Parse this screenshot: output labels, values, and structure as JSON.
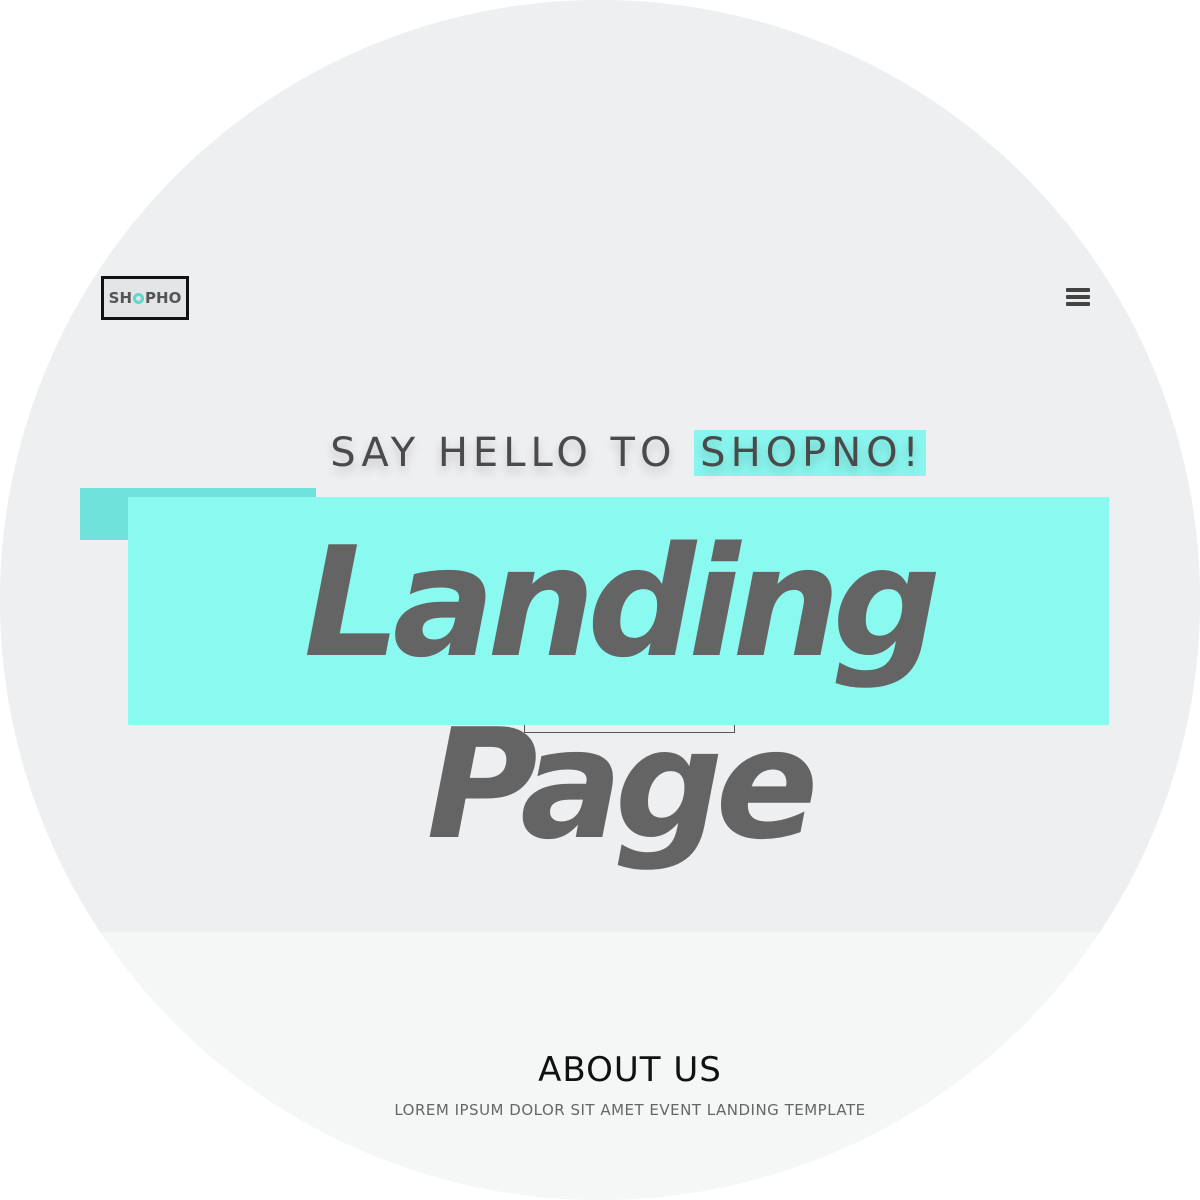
{
  "navbar": {
    "logo_left": "SH",
    "logo_right": "PHO",
    "menu_icon": "hamburger-menu-icon"
  },
  "hero": {
    "subtitle_plain": "SAY HELLO TO ",
    "subtitle_highlight": "SHOPNO!",
    "title": "Landing Page"
  },
  "about": {
    "title": "ABOUT US",
    "subtitle": "LOREM IPSUM DOLOR SIT AMET EVENT LANDING TEMPLATE"
  },
  "colors": {
    "accent": "#8af9f0",
    "accent_dark": "#6fe2dc",
    "text_dark": "#646464",
    "background": "#eeeff1"
  }
}
